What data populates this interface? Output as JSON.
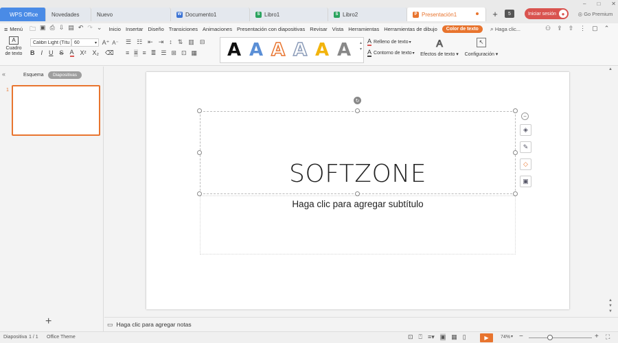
{
  "tabs": {
    "wps": "WPS Office",
    "novedades": "Novedades",
    "nuevo": "Nuevo",
    "doc": "Documento1",
    "libro1": "Libro1",
    "libro2": "Libro2",
    "pres": "Presentación1",
    "count": "5",
    "login": "Iniciar sesión",
    "premium": "Go Premium"
  },
  "menu": {
    "menu_label": "Menú",
    "items": [
      "Inicio",
      "Insertar",
      "Diseño",
      "Transiciones",
      "Animaciones",
      "Presentación con diapositivas",
      "Revisar",
      "Vista",
      "Herramientas",
      "Herramientas de dibujo"
    ],
    "color_texto": "Color de texto",
    "search_placeholder": "Haga clic..."
  },
  "ribbon": {
    "cuadro_line1": "Cuadro",
    "cuadro_line2": "de texto",
    "font_name": "Calibri Light (Títu",
    "font_size": "60",
    "relleno": "Relleno de texto",
    "contorno": "Contorno de texto",
    "efectos": "Efectos de texto",
    "configuracion": "Configuración",
    "style_letter": "A"
  },
  "panel": {
    "esquema": "Esquema",
    "diapositivas": "Diapositivas",
    "slide_number": "1"
  },
  "slide": {
    "title": "SOFTZONE",
    "subtitle": "Haga clic para agregar subtítulo"
  },
  "notes": {
    "placeholder": "Haga clic para agregar notas"
  },
  "status": {
    "slide_label": "Diapositiva",
    "slide_count": "1 / 1",
    "theme": "Office Theme",
    "zoom": "74%"
  },
  "colors": {
    "accent_orange": "#e8742e",
    "wps_blue": "#4a8be6",
    "login_red": "#d9534f"
  }
}
